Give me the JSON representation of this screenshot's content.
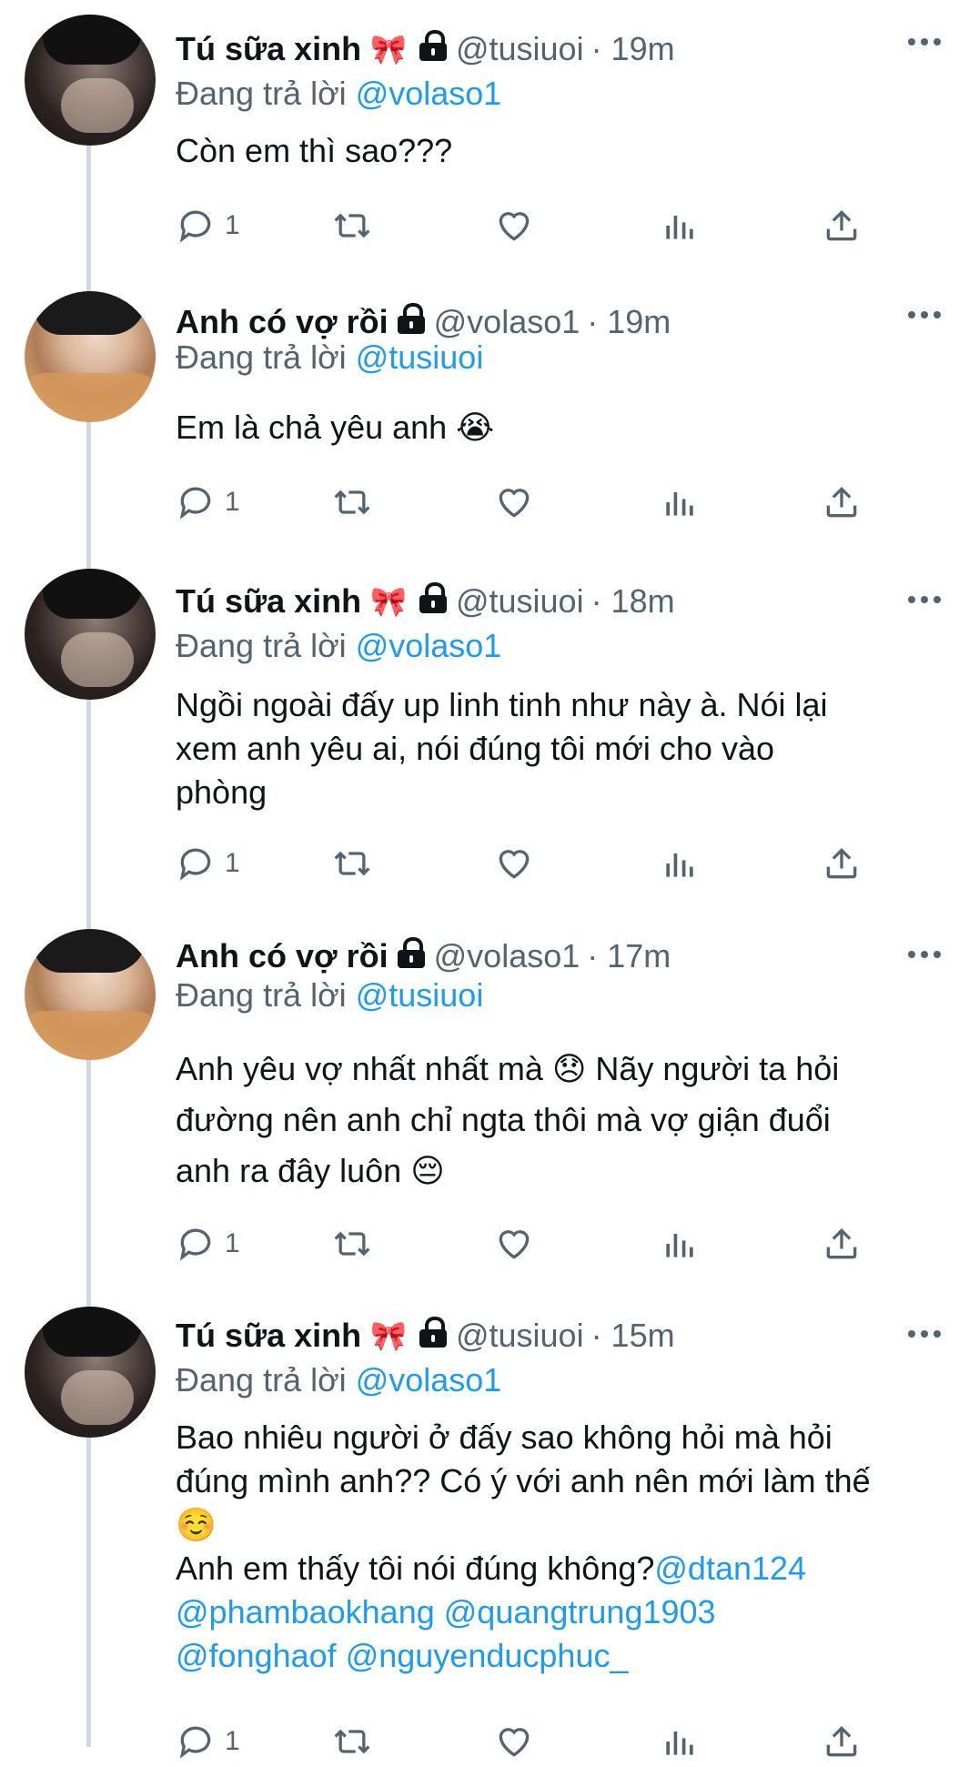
{
  "tweets": [
    {
      "name": "Tú sữa xinh",
      "emoji": "🎀",
      "locked": true,
      "handle": "@tusiuoi",
      "time": "· 19m",
      "reply_prefix": "Đang trả lời",
      "reply_to": "@volaso1",
      "text": [
        "Còn em thì sao???"
      ],
      "reply_count": "1"
    },
    {
      "name": "Anh có vợ rồi",
      "emoji": "",
      "locked": true,
      "handle": "@volaso1",
      "time": "· 19m",
      "reply_prefix": "Đang trả lời",
      "reply_to": "@tusiuoi",
      "text": [
        "Em là chả yêu anh 😭"
      ],
      "reply_count": "1"
    },
    {
      "name": "Tú sữa xinh",
      "emoji": "🎀",
      "locked": true,
      "handle": "@tusiuoi",
      "time": "· 18m",
      "reply_prefix": "Đang trả lời",
      "reply_to": "@volaso1",
      "text": [
        "Ngồi ngoài đấy up linh tinh như này à. Nói lại",
        "xem anh yêu ai, nói đúng tôi mới cho vào",
        "phòng"
      ],
      "reply_count": "1"
    },
    {
      "name": "Anh có vợ rồi",
      "emoji": "",
      "locked": true,
      "handle": "@volaso1",
      "time": "· 17m",
      "reply_prefix": "Đang trả lời",
      "reply_to": "@tusiuoi",
      "text": [
        "Anh yêu vợ nhất nhất mà 😞 Nãy người ta hỏi",
        "đường nên anh chỉ ngta thôi mà vợ giận đuổi",
        "anh ra đây luôn 😔"
      ],
      "reply_count": "1"
    },
    {
      "name": "Tú sữa xinh",
      "emoji": "🎀",
      "locked": true,
      "handle": "@tusiuoi",
      "time": "· 15m",
      "reply_prefix": "Đang trả lời",
      "reply_to": "@volaso1",
      "text": [
        "Bao nhiêu người ở đấy sao không hỏi mà hỏi",
        "đúng mình anh?? Có ý với anh nên mới làm thế",
        "☺️"
      ],
      "text_mentions_line": "Anh em thấy tôi nói đúng không?",
      "mentions": [
        "@dtan124",
        "@phambaokhang",
        "@quangtrung1903",
        "@fonghaof",
        "@nguyenducphuc_"
      ],
      "reply_count": "1"
    }
  ],
  "icons": {
    "reply": "reply-icon",
    "retweet": "retweet-icon",
    "like": "heart-icon",
    "views": "views-icon",
    "share": "share-icon",
    "more": "more-icon",
    "lock": "lock-icon"
  },
  "colors": {
    "text": "#0f1419",
    "secondary": "#536471",
    "mention": "#1d9bf0",
    "thread_line": "#cfd9de",
    "bow": "#e8779a"
  }
}
